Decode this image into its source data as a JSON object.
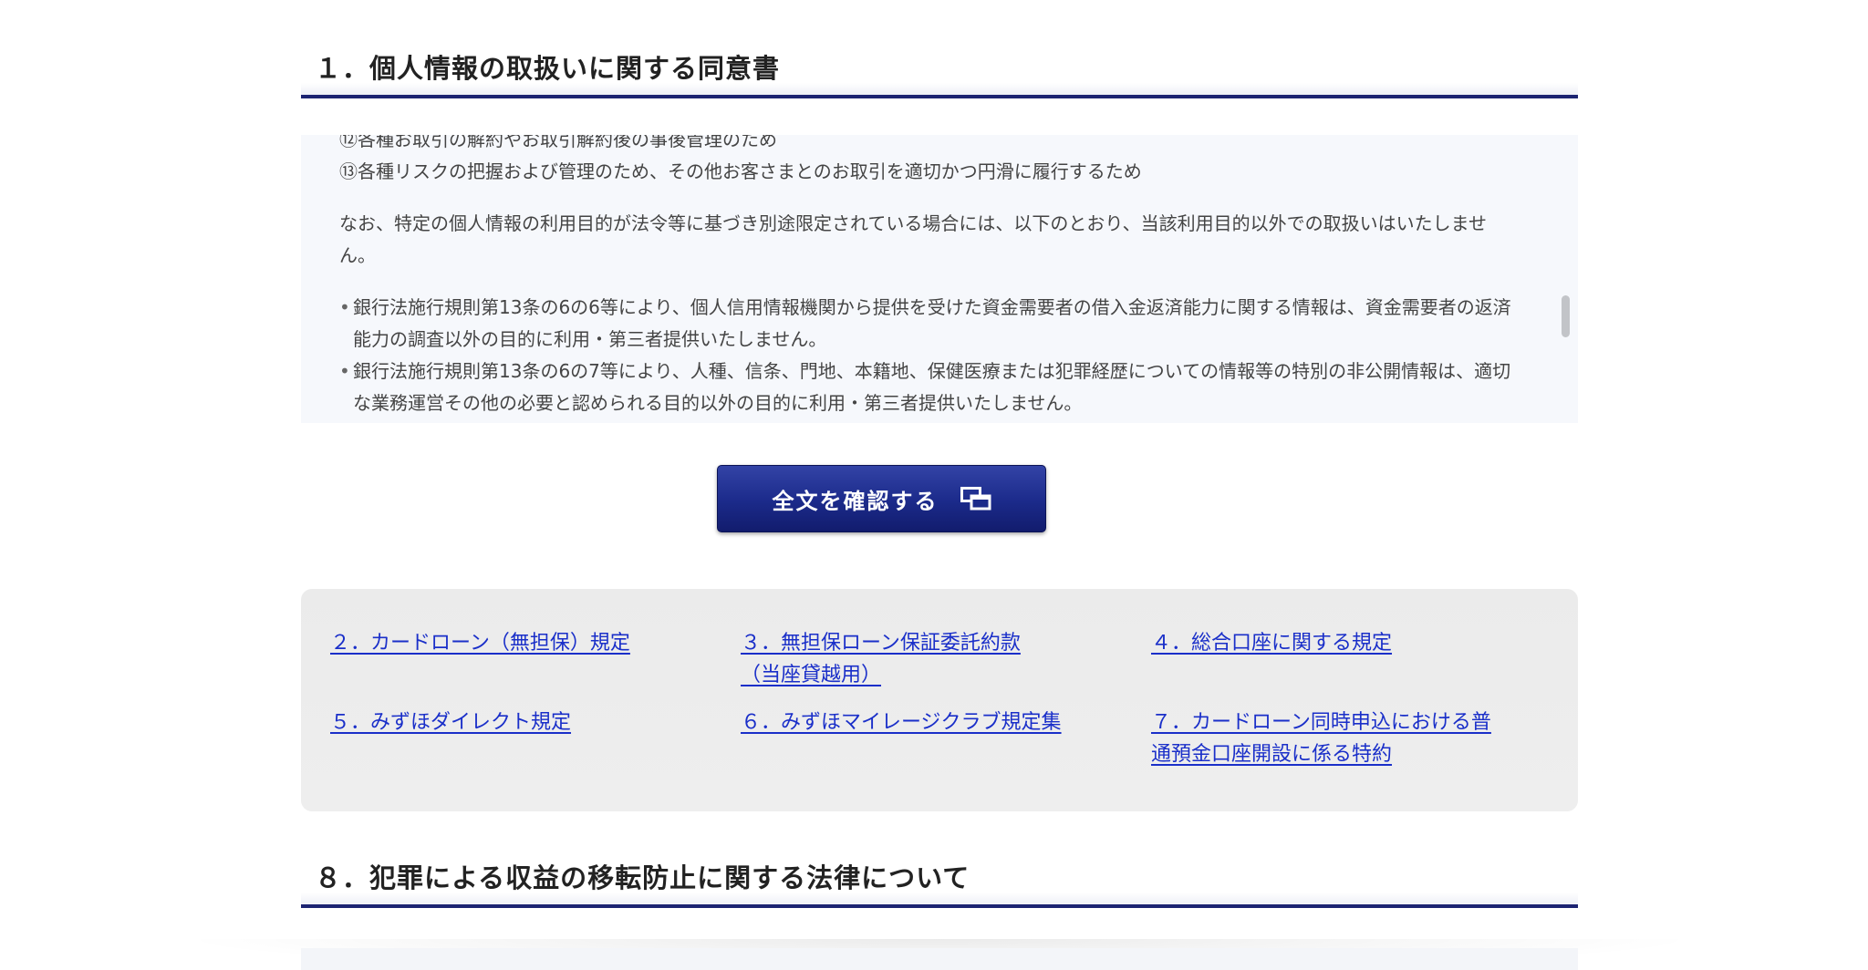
{
  "section1": {
    "heading": "１．個人情報の取扱いに関する同意書",
    "partial_top_line": "⑫各種お取引の解約やお取引解約後の事後管理のため",
    "line13": "⑬各種リスクの把握および管理のため、その他お客さまとのお取引を適切かつ円滑に履行するため",
    "note": "なお、特定の個人情報の利用目的が法令等に基づき別途限定されている場合には、以下のとおり、当該利用目的以外での取扱いはいたしません。",
    "bullets": [
      "銀行法施行規則第13条の6の6等により、個人信用情報機関から提供を受けた資金需要者の借入金返済能力に関する情報は、資金需要者の返済能力の調査以外の目的に利用・第三者提供いたしません。",
      "銀行法施行規則第13条の6の7等により、人種、信条、門地、本籍地、保健医療または犯罪経歴についての情報等の特別の非公開情報は、適切な業務運営その他の必要と認められる目的以外の目的に利用・第三者提供いたしません。"
    ],
    "confirm_button_label": "全文を確認する"
  },
  "links": [
    {
      "label": "２．カードローン（無担保）規定"
    },
    {
      "label": "３．無担保ローン保証委託約款（当座貸越用）"
    },
    {
      "label": "４．総合口座に関する規定"
    },
    {
      "label": "５．みずほダイレクト規定"
    },
    {
      "label": "６．みずほマイレージクラブ規定集"
    },
    {
      "label": "７．カードローン同時申込における普通預金口座開設に係る特約"
    }
  ],
  "section8": {
    "heading": "８．犯罪による収益の移転防止に関する法律について"
  },
  "icons": {
    "confirm_button_icon": "new-window-icon"
  },
  "colors": {
    "heading_rule": "#1c2472",
    "button": "#1b2a8a",
    "link": "#1a2fc9"
  }
}
